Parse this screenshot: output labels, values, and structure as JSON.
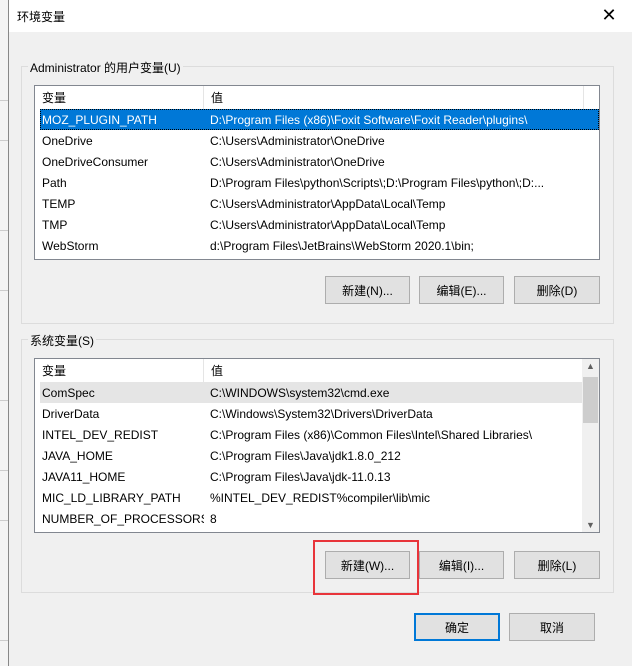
{
  "dialog": {
    "title": "环境变量",
    "close_icon": "close-icon"
  },
  "user_vars": {
    "label": "Administrator 的用户变量(U)",
    "columns": [
      "变量",
      "值"
    ],
    "rows": [
      {
        "name": "MOZ_PLUGIN_PATH",
        "value": "D:\\Program Files (x86)\\Foxit Software\\Foxit Reader\\plugins\\"
      },
      {
        "name": "OneDrive",
        "value": "C:\\Users\\Administrator\\OneDrive"
      },
      {
        "name": "OneDriveConsumer",
        "value": "C:\\Users\\Administrator\\OneDrive"
      },
      {
        "name": "Path",
        "value": "D:\\Program Files\\python\\Scripts\\;D:\\Program Files\\python\\;D:..."
      },
      {
        "name": "TEMP",
        "value": "C:\\Users\\Administrator\\AppData\\Local\\Temp"
      },
      {
        "name": "TMP",
        "value": "C:\\Users\\Administrator\\AppData\\Local\\Temp"
      },
      {
        "name": "WebStorm",
        "value": "d:\\Program Files\\JetBrains\\WebStorm 2020.1\\bin;"
      }
    ],
    "buttons": {
      "new": "新建(N)...",
      "edit": "编辑(E)...",
      "delete": "删除(D)"
    }
  },
  "system_vars": {
    "label": "系统变量(S)",
    "columns": [
      "变量",
      "值"
    ],
    "rows": [
      {
        "name": "ComSpec",
        "value": "C:\\WINDOWS\\system32\\cmd.exe"
      },
      {
        "name": "DriverData",
        "value": "C:\\Windows\\System32\\Drivers\\DriverData"
      },
      {
        "name": "INTEL_DEV_REDIST",
        "value": "C:\\Program Files (x86)\\Common Files\\Intel\\Shared Libraries\\"
      },
      {
        "name": "JAVA_HOME",
        "value": "C:\\Program Files\\Java\\jdk1.8.0_212"
      },
      {
        "name": "JAVA11_HOME",
        "value": "C:\\Program Files\\Java\\jdk-11.0.13"
      },
      {
        "name": "MIC_LD_LIBRARY_PATH",
        "value": "%INTEL_DEV_REDIST%compiler\\lib\\mic"
      },
      {
        "name": "NUMBER_OF_PROCESSORS",
        "value": "8"
      }
    ],
    "buttons": {
      "new": "新建(W)...",
      "edit": "编辑(I)...",
      "delete": "删除(L)"
    }
  },
  "footer": {
    "ok": "确定",
    "cancel": "取消"
  },
  "colors": {
    "selection": "#0078d7",
    "highlight_box": "#e8343a"
  }
}
